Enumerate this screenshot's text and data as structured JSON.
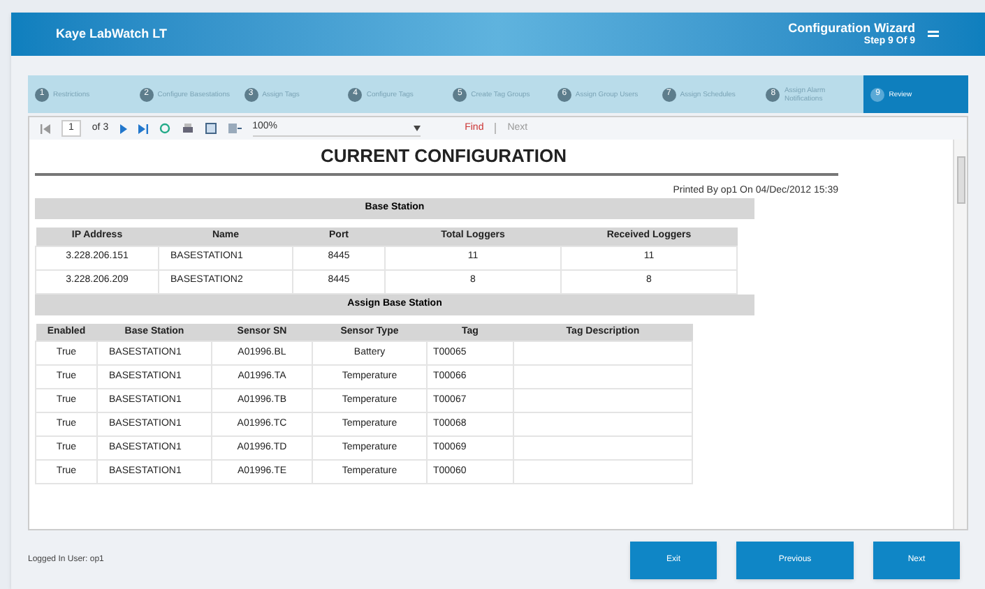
{
  "window": {
    "title": "Kaye LabWatch LT",
    "wizard_title": "Configuration Wizard",
    "wizard_step": "Step 9 Of 9"
  },
  "steps": [
    {
      "number": "1",
      "label": "Restrictions",
      "selected": false
    },
    {
      "number": "2",
      "label": "Configure Basestations",
      "selected": false
    },
    {
      "number": "3",
      "label": "Assign Tags",
      "selected": false
    },
    {
      "number": "4",
      "label": "Configure Tags",
      "selected": false
    },
    {
      "number": "5",
      "label": "Create Tag Groups",
      "selected": false
    },
    {
      "number": "6",
      "label": "Assign Group Users",
      "selected": false
    },
    {
      "number": "7",
      "label": "Assign Schedules",
      "selected": false
    },
    {
      "number": "8",
      "label": "Assign Alarm Notifications",
      "selected": false
    },
    {
      "number": "9",
      "label": "Review",
      "selected": true
    }
  ],
  "toolbar": {
    "page": "1",
    "page_count": "of 3",
    "zoom": "100%",
    "find": "Find",
    "next": "Next"
  },
  "report": {
    "title": "CURRENT CONFIGURATION",
    "printed_by": "Printed By op1 On 04/Dec/2012 15:39",
    "sections": [
      {
        "title": "Base Station",
        "columns": [
          "IP Address",
          "Name",
          "Port",
          "Total Loggers",
          "Received Loggers"
        ],
        "rows": [
          [
            "3.228.206.151",
            "BASESTATION1",
            "8445",
            "11",
            "11"
          ],
          [
            "3.228.206.209",
            "BASESTATION2",
            "8445",
            "8",
            "8"
          ]
        ]
      },
      {
        "title": "Assign Base Station",
        "columns": [
          "Enabled",
          "Base Station",
          "Sensor SN",
          "Sensor Type",
          "Tag",
          "Tag Description"
        ],
        "rows": [
          [
            "True",
            "BASESTATION1",
            "A01996.BL",
            "Battery",
            "T00065",
            ""
          ],
          [
            "True",
            "BASESTATION1",
            "A01996.TA",
            "Temperature",
            "T00066",
            ""
          ],
          [
            "True",
            "BASESTATION1",
            "A01996.TB",
            "Temperature",
            "T00067",
            ""
          ],
          [
            "True",
            "BASESTATION1",
            "A01996.TC",
            "Temperature",
            "T00068",
            ""
          ],
          [
            "True",
            "BASESTATION1",
            "A01996.TD",
            "Temperature",
            "T00069",
            ""
          ],
          [
            "True",
            "BASESTATION1",
            "A01996.TE",
            "Temperature",
            "T00060",
            ""
          ]
        ]
      }
    ]
  },
  "status": "Logged In User: op1",
  "buttons": [
    "Exit",
    "Previous",
    "Next"
  ]
}
